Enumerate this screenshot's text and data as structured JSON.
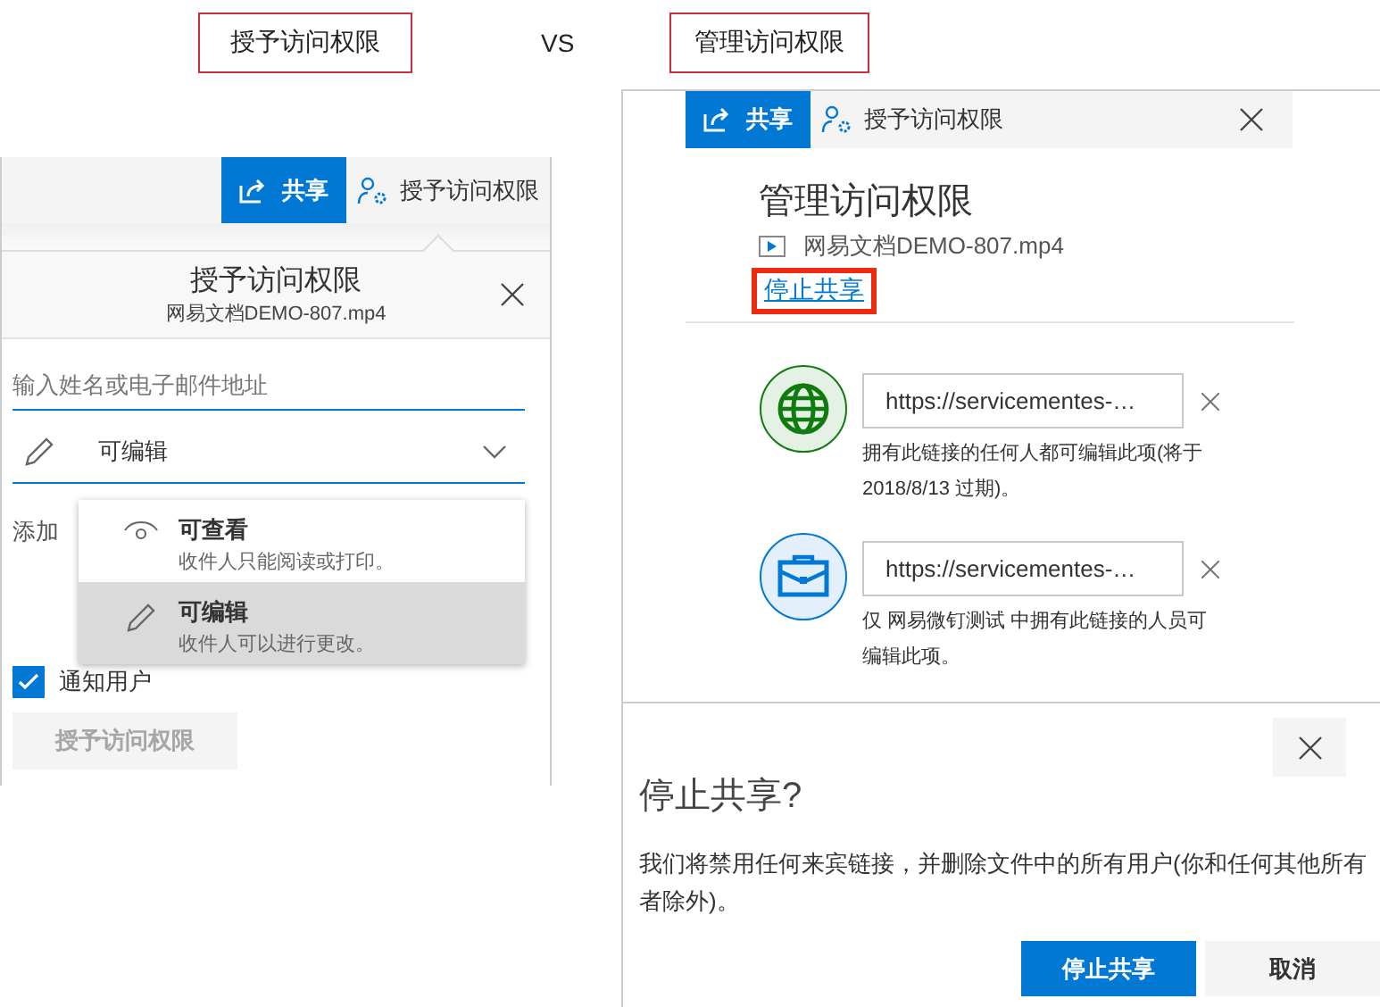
{
  "labels": {
    "left": "授予访问权限",
    "versus": "VS",
    "right": "管理访问权限"
  },
  "grant_panel": {
    "share_button": "共享",
    "grant_tab": "授予访问权限",
    "title": "授予访问权限",
    "file": "网易文档DEMO-807.mp4",
    "placeholder": "输入姓名或电子邮件地址",
    "permission": "可编辑",
    "add_text": "添加",
    "menu": [
      {
        "kind": "view",
        "title": "可查看",
        "description": "收件人只能阅读或打印。",
        "selected": false
      },
      {
        "kind": "edit",
        "title": "可编辑",
        "description": "收件人可以进行更改。",
        "selected": true
      }
    ],
    "notify": {
      "label": "通知用户",
      "checked": true
    },
    "submit": {
      "label": "授予访问权限",
      "disabled": true
    }
  },
  "manage_panel": {
    "share_button": "共享",
    "grant_tab": "授予访问权限",
    "title": "管理访问权限",
    "file": "网易文档DEMO-807.mp4",
    "stop_link": {
      "label": "停止共享",
      "highlighted": true
    },
    "links": [
      {
        "kind": "anyone",
        "url": "https://servicementes-…",
        "description": "拥有此链接的任何人都可编辑此项(将于 2018/8/13 过期)。"
      },
      {
        "kind": "organization",
        "url": "https://servicementes-…",
        "description": "仅 网易微钉测试 中拥有此链接的人员可编辑此项。"
      }
    ]
  },
  "dialog": {
    "title": "停止共享?",
    "body": "我们将禁用任何来宾链接，并删除文件中的所有用户(你和任何其他所有者除外)。",
    "buttons": [
      {
        "label": "停止共享",
        "primary": true
      },
      {
        "label": "取消",
        "primary": false
      }
    ]
  }
}
